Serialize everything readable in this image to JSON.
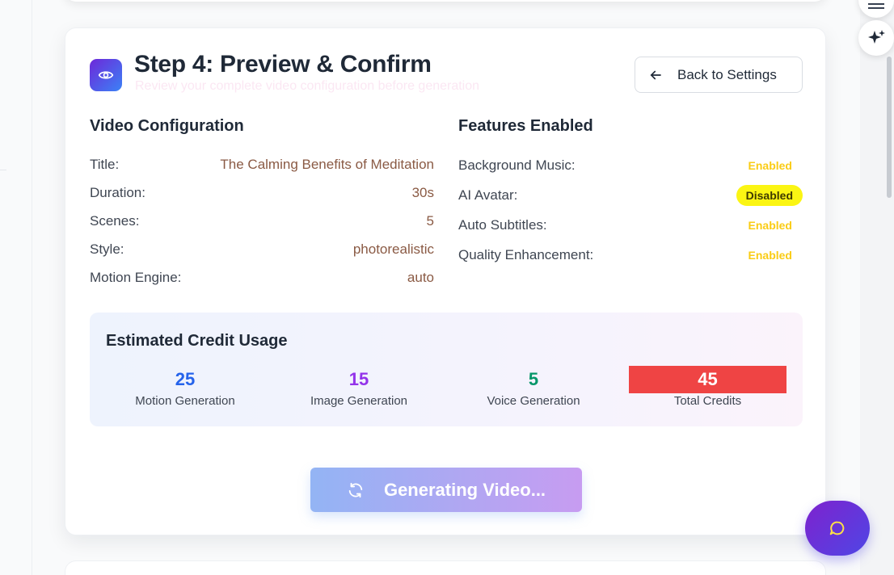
{
  "header": {
    "title": "Step 4: Preview & Confirm",
    "subtitle": "Review your complete video configuration before generation",
    "back_button_label": "Back to Settings",
    "step_icon": "eye-icon"
  },
  "video_configuration": {
    "title": "Video Configuration",
    "rows": [
      {
        "label": "Title:",
        "value": "The Calming Benefits of Meditation"
      },
      {
        "label": "Duration:",
        "value": "30s"
      },
      {
        "label": "Scenes:",
        "value": "5"
      },
      {
        "label": "Style:",
        "value": "photorealistic"
      },
      {
        "label": "Motion Engine:",
        "value": "auto"
      }
    ]
  },
  "features": {
    "title": "Features Enabled",
    "rows": [
      {
        "label": "Background Music:",
        "status": "Enabled"
      },
      {
        "label": "AI Avatar:",
        "status": "Disabled"
      },
      {
        "label": "Auto Subtitles:",
        "status": "Enabled"
      },
      {
        "label": "Quality Enhancement:",
        "status": "Enabled"
      }
    ]
  },
  "credits": {
    "title": "Estimated Credit Usage",
    "items": [
      {
        "value": "25",
        "label": "Motion Generation",
        "color": "#2563eb"
      },
      {
        "value": "15",
        "label": "Image Generation",
        "color": "#9333ea"
      },
      {
        "value": "5",
        "label": "Voice Generation",
        "color": "#059669"
      },
      {
        "value": "45",
        "label": "Total Credits",
        "color": "#ffffff"
      }
    ]
  },
  "generate_button": {
    "label": "Generating Video...",
    "icon": "refresh-icon"
  },
  "colors": {
    "accent_gradient_start": "#93b4f4",
    "accent_gradient_end": "#c79cf1",
    "enabled": "#facc15",
    "disabled_bg": "#fbf513",
    "total_bg": "#ef4444"
  }
}
